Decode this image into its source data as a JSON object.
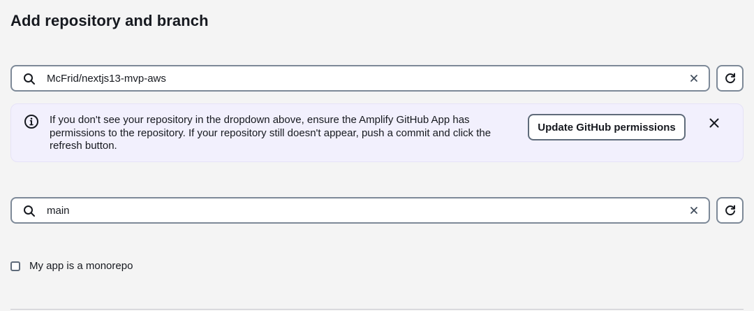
{
  "header": {
    "title": "Add repository and branch"
  },
  "repository": {
    "value": "McFrid/nextjs13-mvp-aws",
    "search_icon": "search-icon",
    "clear_icon": "close-icon",
    "refresh_icon": "refresh-icon"
  },
  "info_banner": {
    "icon": "info-icon",
    "message": "If you don't see your repository in the dropdown above, ensure the Amplify GitHub App has permissions to the repository. If your repository still doesn't appear, push a commit and click the refresh button.",
    "button_label": "Update GitHub permissions",
    "dismiss_icon": "close-icon"
  },
  "branch": {
    "value": "main",
    "search_icon": "search-icon",
    "clear_icon": "close-icon",
    "refresh_icon": "refresh-icon"
  },
  "monorepo": {
    "label": "My app is a monorepo",
    "checked": false
  },
  "colors": {
    "border": "#7d8998",
    "banner_bg": "#f2f0fd",
    "text": "#16191f",
    "page_bg": "#f4f4f4"
  }
}
